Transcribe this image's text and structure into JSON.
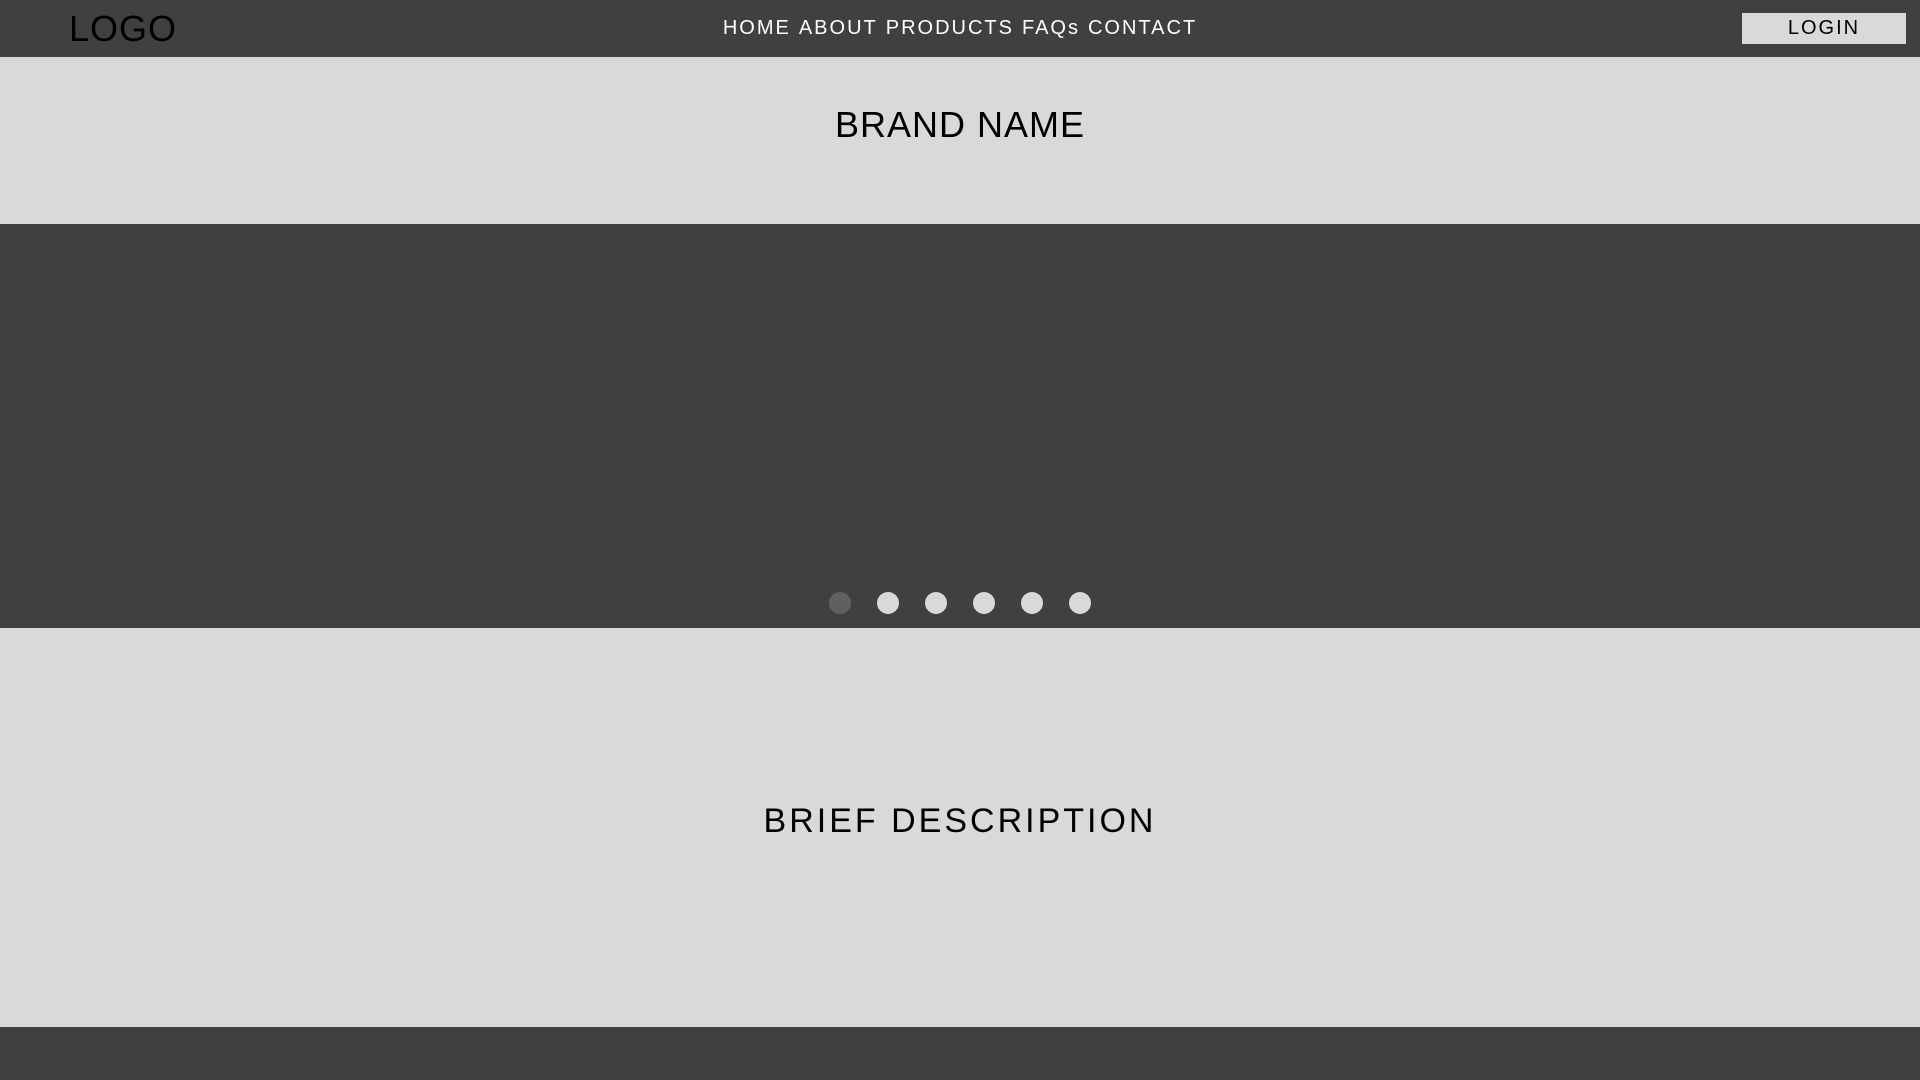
{
  "header": {
    "logo": "LOGO",
    "nav": [
      "HOME",
      "ABOUT",
      "PRODUCTS",
      "FAQs",
      "CONTACT"
    ],
    "login_label": "LOGIN"
  },
  "brand": {
    "title": "BRAND NAME"
  },
  "carousel": {
    "slide_count": 6,
    "active_index": 0
  },
  "description": {
    "text": "BRIEF DESCRIPTION"
  },
  "colors": {
    "dark": "#404040",
    "light": "#d9d9d9",
    "active_dot": "#606060",
    "text_dark": "#000000",
    "text_light": "#ffffff"
  }
}
